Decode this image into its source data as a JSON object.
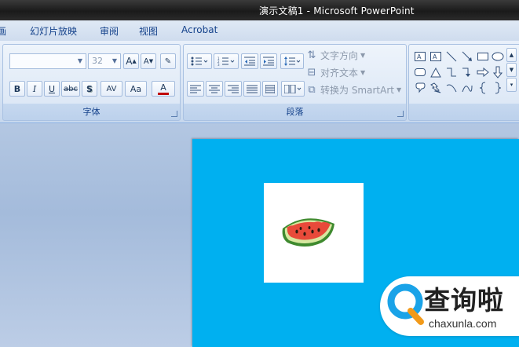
{
  "window": {
    "title": "演示文稿1 - Microsoft PowerPoint"
  },
  "tabs": [
    {
      "label": "画"
    },
    {
      "label": "幻灯片放映"
    },
    {
      "label": "审阅"
    },
    {
      "label": "视图"
    },
    {
      "label": "Acrobat"
    }
  ],
  "font_group": {
    "label": "字体",
    "font_name_value": "",
    "font_size_value": "32",
    "grow_label": "A",
    "shrink_label": "A",
    "bold": "B",
    "italic": "I",
    "underline": "U",
    "strike": "abc",
    "shadow": "S",
    "spacing": "AV",
    "case": "Aa",
    "color": "A"
  },
  "paragraph_group": {
    "label": "段落",
    "text_direction": "文字方向",
    "align_text": "对齐文本",
    "smartart": "转换为 SmartArt"
  },
  "colors": {
    "slide": "#00b0f0",
    "font_color_bar": "#c00000"
  },
  "watermark": {
    "title": "查询啦",
    "domain": "chaxunla.com"
  }
}
